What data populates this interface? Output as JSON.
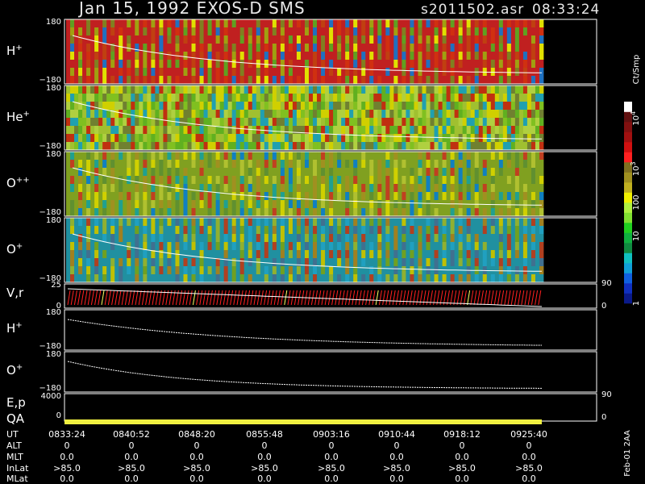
{
  "header": {
    "title": "Jan 15, 1992    EXOS-D SMS",
    "file": "s2011502.asr",
    "time": "08:33:24"
  },
  "panels": [
    {
      "id": "h-plus",
      "label": "H",
      "sup": "+",
      "ymax": "180",
      "ymin": "−180",
      "color_mode": "red"
    },
    {
      "id": "he-plus",
      "label": "He",
      "sup": "+",
      "ymax": "180",
      "ymin": "−180",
      "color_mode": "green"
    },
    {
      "id": "o-plusplus",
      "label": "O",
      "sup": "++",
      "ymax": "180",
      "ymin": "−180",
      "color_mode": "mixed"
    },
    {
      "id": "o-plus",
      "label": "O",
      "sup": "+",
      "ymax": "180",
      "ymin": "−180",
      "color_mode": "blue"
    }
  ],
  "vr_panel": {
    "label": "V,r",
    "ymax": "25",
    "ymin": "0",
    "right_top": "90",
    "right_bottom": "0"
  },
  "line_panels": [
    {
      "id": "h-plus-line",
      "label": "H",
      "sup": "+",
      "ymax": "180",
      "ymin": "−180"
    },
    {
      "id": "o-plus-line",
      "label": "O",
      "sup": "+",
      "ymax": "180",
      "ymin": "−180"
    }
  ],
  "ep_panel": {
    "label1": "E,p",
    "label2": "QA",
    "ytop": "4000",
    "ybottom": "0",
    "right_top": "90",
    "right_bottom": "0"
  },
  "colorbar": {
    "unit": "Ct/Smp",
    "ticks": [
      {
        "label": "1",
        "frac": 0.0
      },
      {
        "label": "10",
        "frac": 0.333
      },
      {
        "label": "100",
        "frac": 0.5
      },
      {
        "label": "10",
        "sup": "3",
        "frac": 0.667
      },
      {
        "label": "10",
        "sup": "4",
        "frac": 0.917
      }
    ],
    "colors": [
      "#0a1a8a",
      "#1030c0",
      "#1060e0",
      "#10a0d8",
      "#10c0c0",
      "#108a40",
      "#10b040",
      "#20d020",
      "#80e030",
      "#b0f040",
      "#f0f000",
      "#c0b020",
      "#a09020",
      "#807020",
      "#ff2020",
      "#d01010",
      "#a01010",
      "#801010",
      "#601010",
      "#ffffff"
    ]
  },
  "footer": {
    "rows": [
      {
        "name": "UT",
        "values": [
          "0833:24",
          "0840:52",
          "0848:20",
          "0855:48",
          "0903:16",
          "0910:44",
          "0918:12",
          "0925:40"
        ]
      },
      {
        "name": "ALT",
        "values": [
          "0",
          "0",
          "0",
          "0",
          "0",
          "0",
          "0",
          "0"
        ]
      },
      {
        "name": "MLT",
        "values": [
          "0.0",
          "0.0",
          "0.0",
          "0.0",
          "0.0",
          "0.0",
          "0.0",
          "0.0"
        ]
      },
      {
        "name": "InLat",
        "values": [
          ">85.0",
          ">85.0",
          ">85.0",
          ">85.0",
          ">85.0",
          ">85.0",
          ">85.0",
          ">85.0"
        ]
      },
      {
        "name": "MLat",
        "values": [
          "0.0",
          "0.0",
          "0.0",
          "0.0",
          "0.0",
          "0.0",
          "0.0",
          "0.0"
        ]
      }
    ],
    "stamp": "Feb-01 2AA"
  }
}
